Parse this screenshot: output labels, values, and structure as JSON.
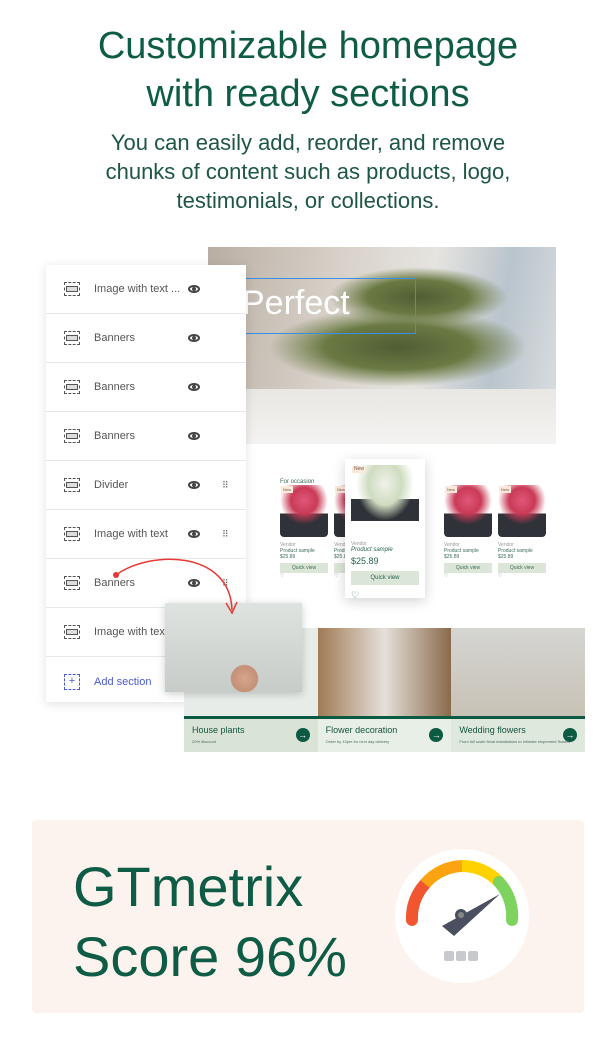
{
  "header": {
    "title_line1": "Customizable homepage",
    "title_line2": "with ready sections",
    "subtitle_line1": "You can easily add, reorder, and remove",
    "subtitle_line2": "chunks of content such as products, logo,",
    "subtitle_line3": "testimonials, or collections."
  },
  "sections": [
    {
      "label": "Image with text ...",
      "icon": "image-text-icon"
    },
    {
      "label": "Banners",
      "icon": "banner-icon"
    },
    {
      "label": "Banners",
      "icon": "banner-icon"
    },
    {
      "label": "Banners",
      "icon": "banner-icon"
    },
    {
      "label": "Divider",
      "icon": "banner-icon"
    },
    {
      "label": "Image with text",
      "icon": "image-text-icon"
    },
    {
      "label": "Banners",
      "icon": "banner-icon"
    },
    {
      "label": "Image with text",
      "icon": "image-text-icon"
    }
  ],
  "add_section": "Add section",
  "hero": {
    "text": "Perfect"
  },
  "products": {
    "heading": "For occasion",
    "badge": "New",
    "vendor": "Vendor",
    "name": "Product sample",
    "price": "$25.89",
    "button": "Quick view"
  },
  "collections": [
    {
      "title": "House plants",
      "desc": "20% discount"
    },
    {
      "title": "Flower decoration",
      "desc": "Order by 10pm for next day delivery"
    },
    {
      "title": "Wedding flowers",
      "desc": "From full scale floral installations to intimate elopement flowers"
    }
  ],
  "gtmetrix": {
    "line1": "GTmetrix",
    "line2": "Score 96%",
    "score": 96
  },
  "colors": {
    "brand": "#0e5c45",
    "panel_bg": "#fcf3ee",
    "selection": "#3a8ee6"
  }
}
